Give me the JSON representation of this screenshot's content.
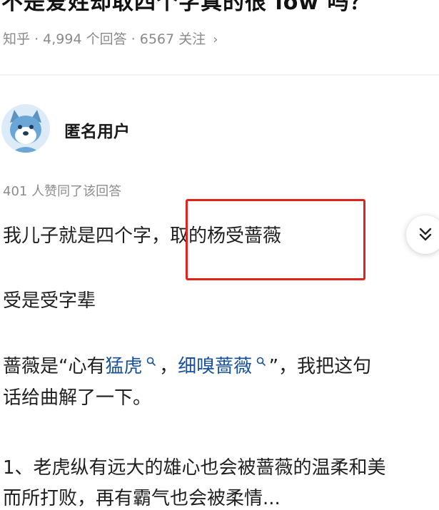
{
  "question": {
    "title": "不是爱姓却取四个字真的很 low 吗？",
    "source": "知乎",
    "sep": "·",
    "answers": "4,994 个回答",
    "followers": "6567 关注",
    "chevron": "›"
  },
  "answer": {
    "author": "匿名用户",
    "avatar_icon": "anonymous-avatar-icon",
    "votes": "401 人赞同了该回答",
    "p1_a": "我儿子就是四个字，",
    "p1_b": "取的杨受蔷薇",
    "p2": "受是受字辈",
    "p3_a": "蔷薇是“心有",
    "p3_link1": "猛虎",
    "p3_comma": "，",
    "p3_link2": "细嗅蔷薇",
    "p3_b": "”，我把这句",
    "p4": "话给曲解了一下。",
    "p5": "1、老虎纵有远大的雄心也会被蔷薇的温柔和美",
    "p6": "而所打败，再有霸气也会被柔情..."
  },
  "colors": {
    "link": "#175199",
    "highlight": "#e0241d",
    "meta": "#8a8a8a"
  },
  "icons": {
    "collapse": "double-chevron-down-icon",
    "search_mark": "search-icon"
  }
}
